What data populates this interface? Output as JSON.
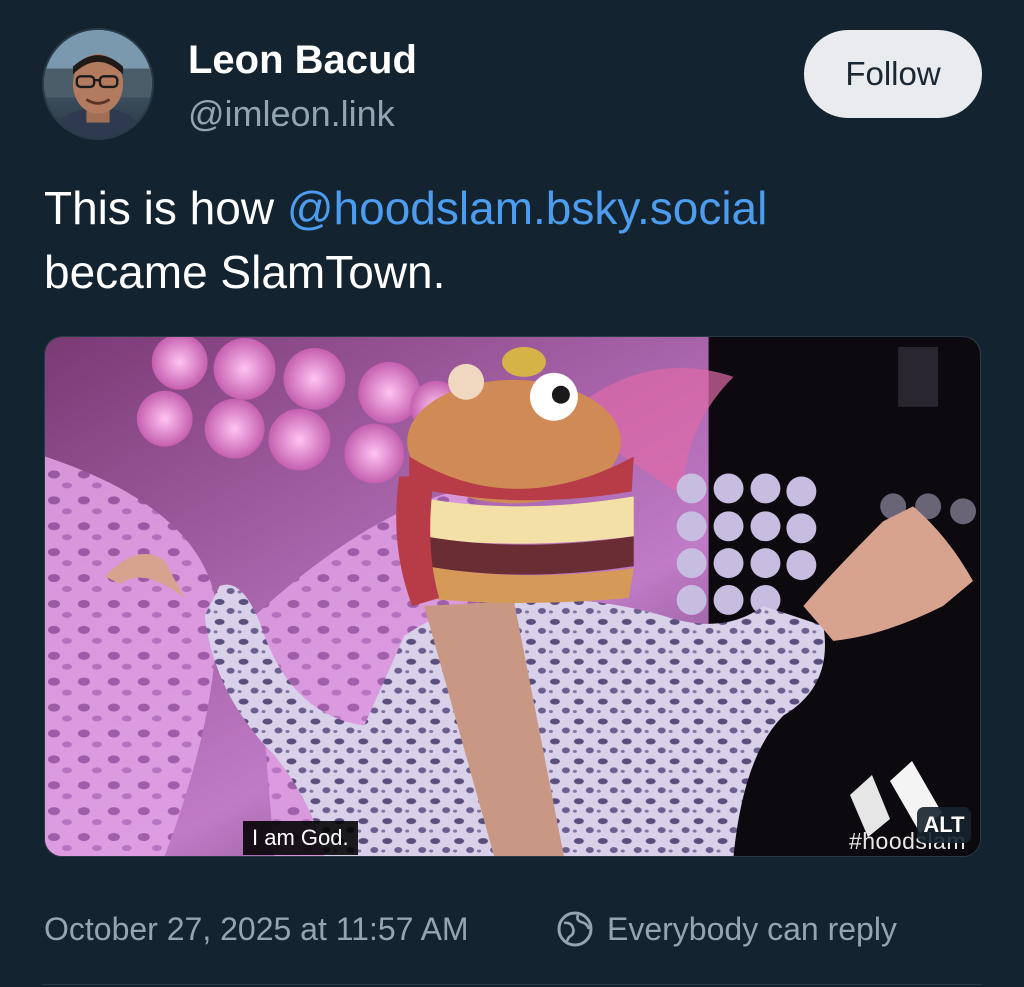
{
  "author": {
    "display_name": "Leon Bacud",
    "handle": "@imleon.link",
    "avatar_alt": "avatar"
  },
  "follow_button": {
    "label": "Follow"
  },
  "post": {
    "text_prefix": "This is how ",
    "mention": "@hoodslam.bsky.social",
    "text_suffix": "became SlamTown."
  },
  "media": {
    "caption": "I am God.",
    "watermark": "#hoodslam",
    "alt_badge": "ALT"
  },
  "meta": {
    "timestamp": "October 27, 2025 at 11:57 AM",
    "reply_setting": "Everybody can reply",
    "reply_icon": "globe-icon"
  },
  "colors": {
    "background": "#13232f",
    "mention": "#4c9cf0",
    "muted": "#93a5b3",
    "follow_bg": "#e9ebee"
  }
}
